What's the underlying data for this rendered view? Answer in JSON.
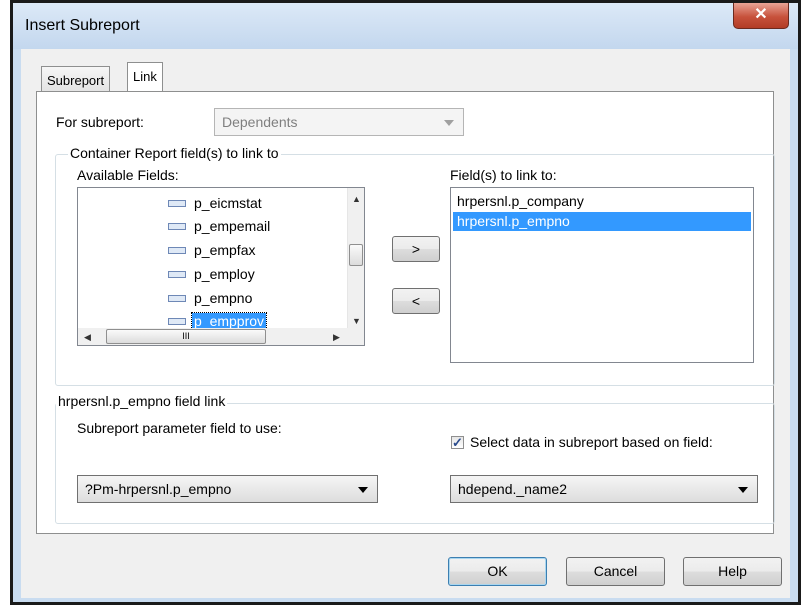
{
  "window": {
    "title": "Insert Subreport",
    "close_glyph": "✕"
  },
  "tabs": [
    {
      "label": "Subreport"
    },
    {
      "label": "Link"
    }
  ],
  "for_subreport": {
    "label": "For subreport:",
    "value": "Dependents"
  },
  "container_group": {
    "title": "Container Report field(s) to link to",
    "available_label": "Available Fields:",
    "available_fields": [
      {
        "name": "p_eicmstat"
      },
      {
        "name": "p_empemail"
      },
      {
        "name": "p_empfax"
      },
      {
        "name": "p_employ"
      },
      {
        "name": "p_empno"
      },
      {
        "name": "p_empprov",
        "selected": true
      }
    ],
    "add_button": ">",
    "remove_button": "<",
    "linked_label": "Field(s) to link to:",
    "linked_fields": [
      {
        "name": "hrpersnl.p_company"
      },
      {
        "name": "hrpersnl.p_empno",
        "selected": true
      }
    ],
    "hscroll_grip": "III"
  },
  "field_link_group": {
    "title": "hrpersnl.p_empno field link",
    "param_label": "Subreport parameter field to use:",
    "param_value": "?Pm-hrpersnl.p_empno",
    "select_data_label": "Select data in subreport based on field:",
    "select_data_checked": true,
    "select_data_field": "hdepend._name2"
  },
  "buttons": {
    "ok": "OK",
    "cancel": "Cancel",
    "help": "Help"
  }
}
